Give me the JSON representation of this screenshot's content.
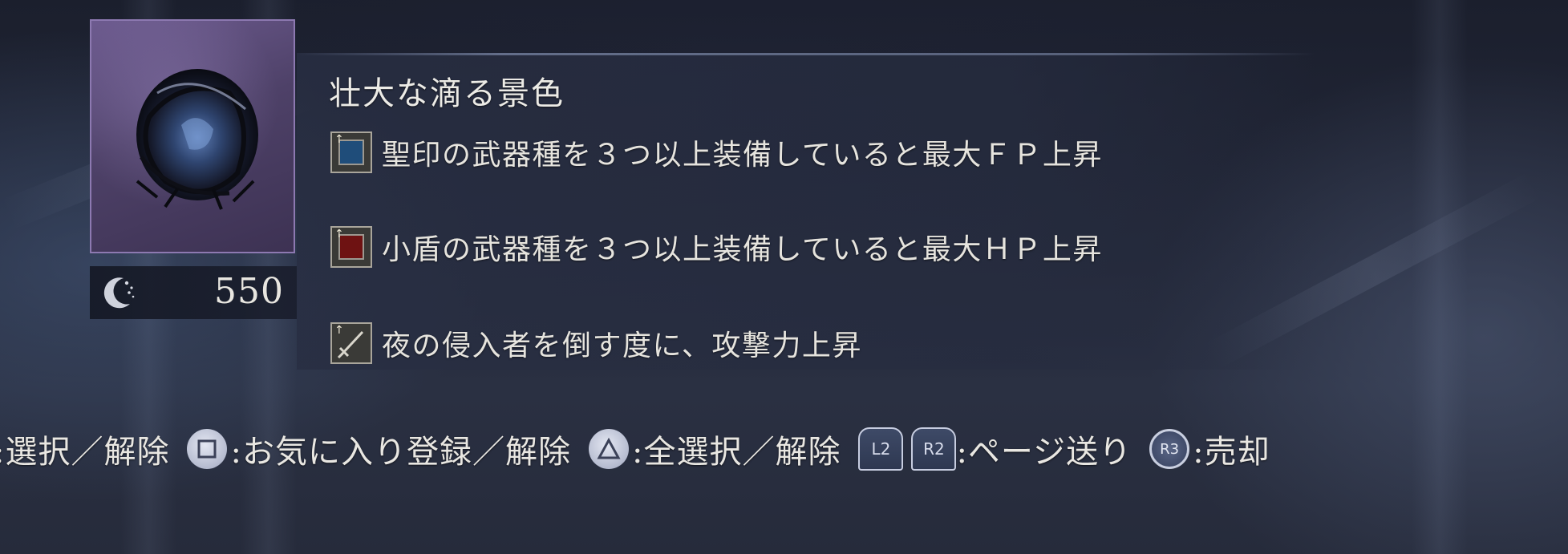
{
  "item": {
    "title": "壮大な滴る景色",
    "price": "550",
    "rarity_color": "#8d79b1"
  },
  "effects": [
    {
      "text": "聖印の武器種を３つ以上装備していると最大ＦＰ上昇",
      "icon": "blue-square-icon",
      "icon_color": "#1f4d7a"
    },
    {
      "text": "小盾の武器種を３つ以上装備していると最大ＨＰ上昇",
      "icon": "red-square-icon",
      "icon_color": "#6e1212"
    },
    {
      "text": "夜の侵入者を倒す度に、攻撃力上昇",
      "icon": "sword-icon",
      "icon_color": "#3a3a37"
    }
  ],
  "controls": [
    {
      "button": "",
      "label": ":選択／解除"
    },
    {
      "button": "square-button-icon",
      "label": ":お気に入り登録／解除"
    },
    {
      "button": "triangle-button-icon",
      "label": ":全選択／解除"
    },
    {
      "button": "L2",
      "label": ""
    },
    {
      "button": "R2",
      "label": ":ページ送り"
    },
    {
      "button": "R3",
      "label": ":売却"
    }
  ]
}
